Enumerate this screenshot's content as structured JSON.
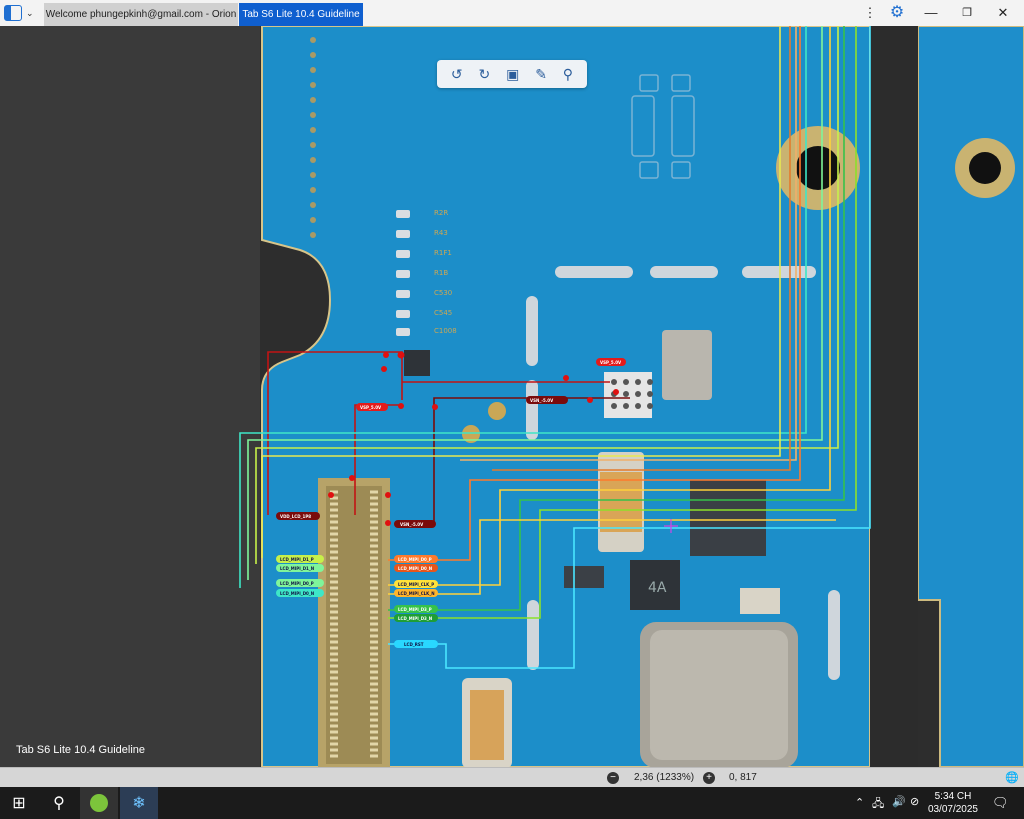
{
  "tabs": [
    {
      "label": "Welcome phungepkinh@gmail.com - Orion"
    },
    {
      "label": "Tab S6 Lite 10.4 Guideline"
    }
  ],
  "document_title": "Tab S6 Lite 10.4 Guideline",
  "zoom_text": "2,36 (1233%)",
  "coords_text": "0, 817",
  "clock": {
    "time": "5:34 CH",
    "date": "03/07/2025"
  },
  "board": {
    "top_labels": [
      "VSP_5.0V",
      "VSP_5.0V",
      "VSN_-5.0V"
    ],
    "left_labels": [
      "VDD_LCD_1P8",
      "LCD_MIPI_D1_P",
      "LCD_MIPI_D1_N",
      "LCD_MIPI_D0_P",
      "LCD_MIPI_D0_N"
    ],
    "right_labels": [
      "VSN_-5.0V",
      "LCD_MIPI_D0_P",
      "LCD_MIPI_D0_N",
      "LCD_MIPI_CLK_P",
      "LCD_MIPI_CLK_N",
      "LCD_MIPI_D3_P",
      "LCD_MIPI_D3_N",
      "LCD_RST"
    ],
    "chip_marking": "4A",
    "silk": [
      "R2R",
      "R43",
      "R1F1",
      "R1B",
      "C530",
      "C545",
      "C1008"
    ]
  },
  "colors": {
    "pcb": "#1c8ec9",
    "accent": "#0f5fcf"
  }
}
